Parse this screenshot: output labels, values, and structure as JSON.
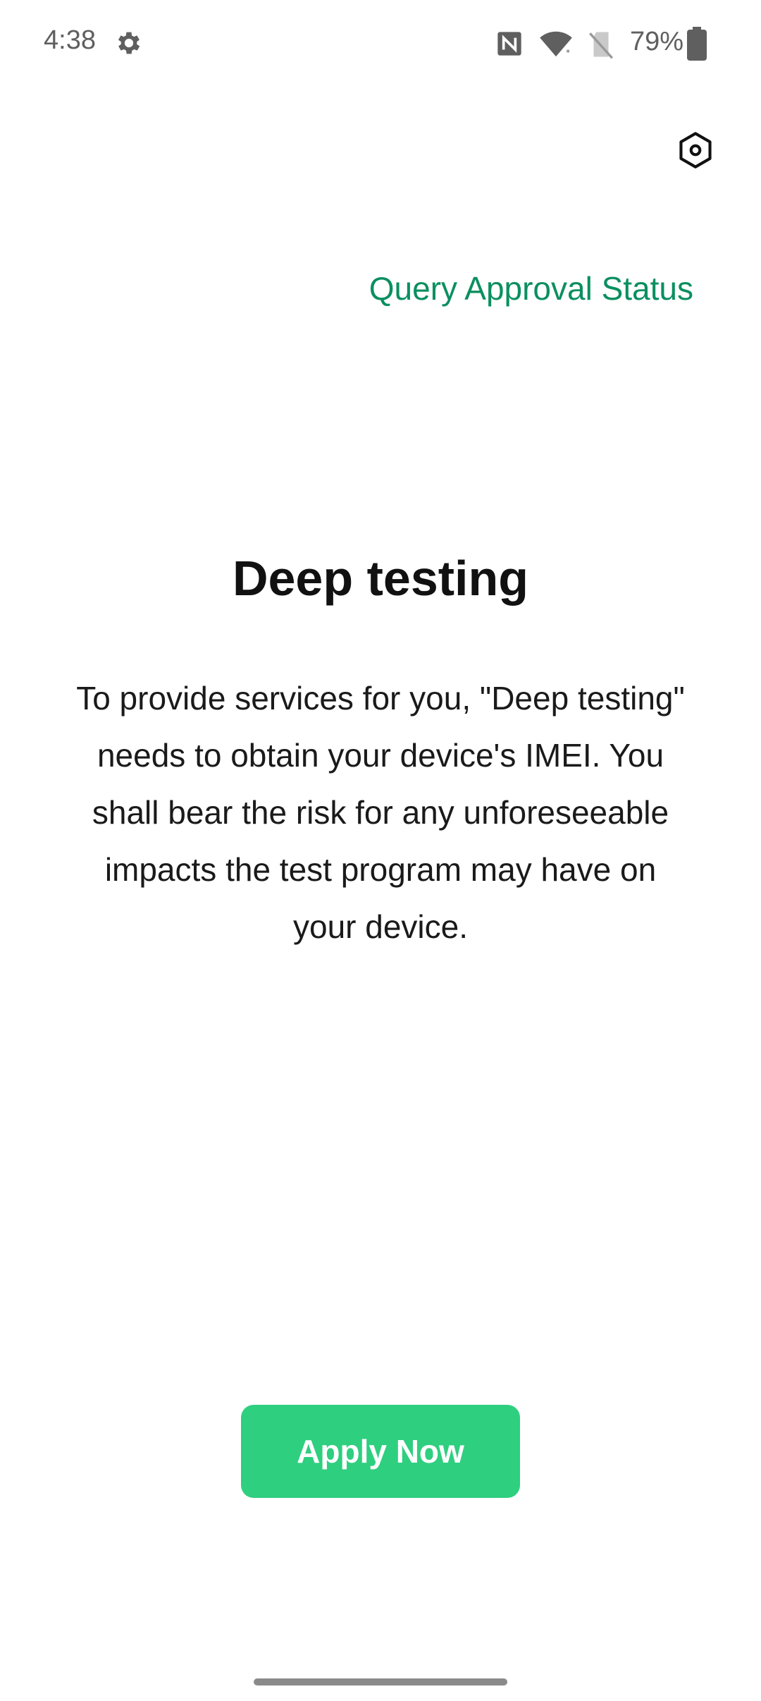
{
  "status_bar": {
    "time": "4:38",
    "battery_percent": "79%",
    "icons": [
      "gear-icon",
      "nfc-icon",
      "wifi-icon",
      "no-sim-icon",
      "battery-icon"
    ],
    "text_color": "#5f5f5f"
  },
  "header": {
    "settings_icon": "settings-hexagon-icon"
  },
  "main": {
    "query_link": "Query Approval Status",
    "title": "Deep testing",
    "description": "To provide services for you, \"Deep testing\" needs to obtain your device's IMEI. You shall bear the risk for any unforeseeable impacts the test program may have on your device.",
    "apply_button": "Apply Now"
  },
  "colors": {
    "accent_link": "#0b8f60",
    "button": "#2ecf7f",
    "background": "#ffffff"
  }
}
